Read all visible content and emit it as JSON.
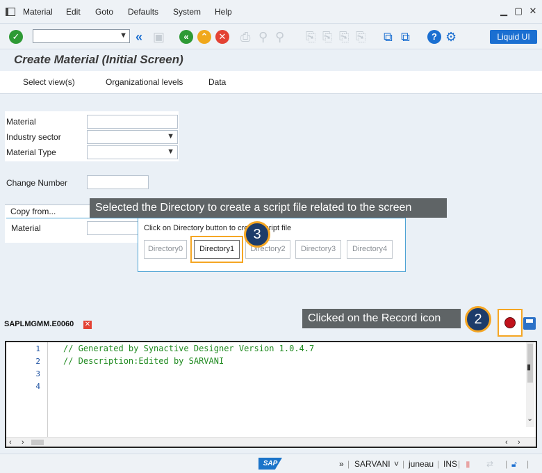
{
  "menu": {
    "items": [
      "Material",
      "Edit",
      "Goto",
      "Defaults",
      "System",
      "Help"
    ]
  },
  "toolbar": {
    "liquid_ui_label": "Liquid UI",
    "icons": [
      "check-icon",
      "back-double-icon",
      "save-icon",
      "back-icon",
      "exit-icon",
      "cancel-icon",
      "print-icon",
      "find-icon",
      "help-icon",
      "settings-icon"
    ]
  },
  "screen": {
    "title": "Create Material (Initial Screen)"
  },
  "app_toolbar": {
    "buttons": [
      "Select view(s)",
      "Organizational levels",
      "Data"
    ]
  },
  "form": {
    "material_label": "Material",
    "industry_sector_label": "Industry sector",
    "material_type_label": "Material Type",
    "change_number_label": "Change Number",
    "copy_from_label": "Copy from...",
    "copy_material_label": "Material"
  },
  "annotations": {
    "directory_caption": "Selected the Directory to create a script file related to the screen",
    "record_caption": "Clicked on the Record icon",
    "step_record": "2",
    "step_directory": "3"
  },
  "directory_popup": {
    "hint": "Click on Directory button to create script file",
    "buttons": [
      "Directory0",
      "Directory1",
      "Directory2",
      "Directory3",
      "Directory4"
    ],
    "selected": "Directory1"
  },
  "editor": {
    "tab_name": "SAPLMGMM.E0060",
    "line_numbers": [
      "1",
      "2",
      "3",
      "4"
    ],
    "lines": [
      "// Generated by Synactive Designer Version 1.0.4.7",
      "// Description:Edited by SARVANI"
    ]
  },
  "status": {
    "user": "SARVANI",
    "client": "juneau",
    "mode": "INS",
    "logo": "SAP"
  },
  "colors": {
    "accent": "#1b6fd1",
    "badge": "#1d3c6a",
    "highlight": "#f5a623",
    "code": "#1f8a1f"
  }
}
